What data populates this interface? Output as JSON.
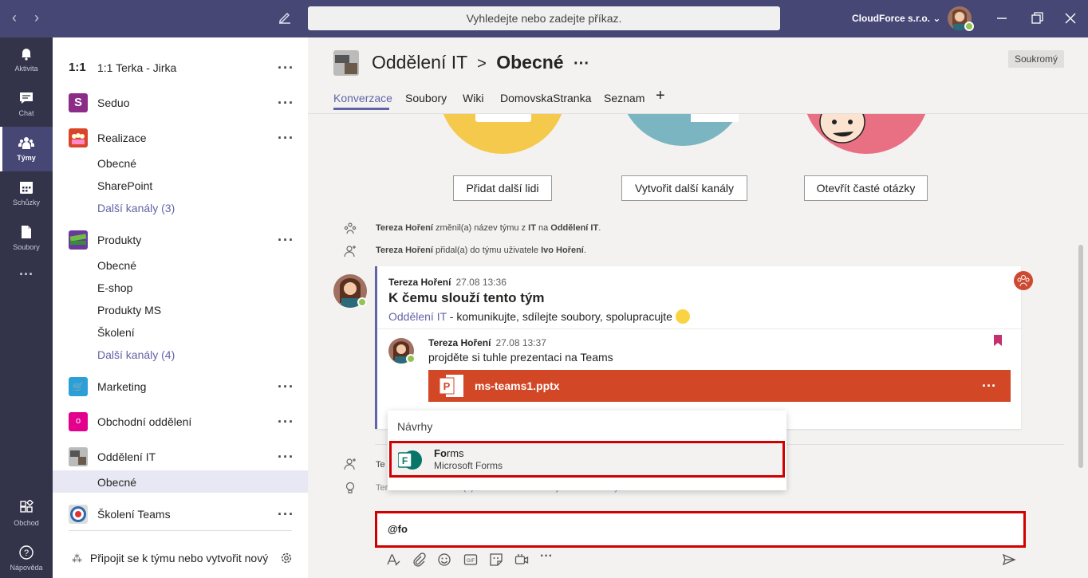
{
  "search": {
    "placeholder": "Vyhledejte nebo zadejte příkaz."
  },
  "org": "CloudForce s.r.o.",
  "rail": [
    {
      "label": "Aktivita",
      "icon": "bell-icon"
    },
    {
      "label": "Chat",
      "icon": "chat-icon"
    },
    {
      "label": "Týmy",
      "icon": "teams-icon"
    },
    {
      "label": "Schůzky",
      "icon": "calendar-icon"
    },
    {
      "label": "Soubory",
      "icon": "files-icon"
    },
    {
      "label": "Obchod",
      "icon": "store-icon"
    },
    {
      "label": "Nápověda",
      "icon": "help-icon"
    }
  ],
  "teams": {
    "t1": "1:1 Terka - Jirka",
    "t1_icon": "1:1",
    "t2": "Seduo",
    "t2_icon": "S",
    "t3": "Realizace",
    "t3_ch1": "Obecné",
    "t3_ch2": "SharePoint",
    "t3_more": "Další kanály (3)",
    "t4": "Produkty",
    "t4_ch1": "Obecné",
    "t4_ch2": "E-shop",
    "t4_ch3": "Produkty MS",
    "t4_ch4": "Školení",
    "t4_more": "Další kanály (4)",
    "t5": "Marketing",
    "t6": "Obchodní oddělení",
    "t6_icon": "o",
    "t7": "Oddělení IT",
    "t7_ch1": "Obecné",
    "t8": "Školení Teams",
    "join": "Připojit se k týmu nebo vytvořit nový"
  },
  "header": {
    "team": "Oddělení IT",
    "sep": ">",
    "channel": "Obecné",
    "private": "Soukromý",
    "tabs": [
      "Konverzace",
      "Soubory",
      "Wiki",
      "DomovskaStranka",
      "Seznam",
      "+"
    ]
  },
  "actions": [
    "Přidat další lidi",
    "Vytvořit další kanály",
    "Otevřít časté otázky"
  ],
  "sys1": {
    "pre": "Tereza Hoření",
    "a": " změnil(a) název týmu z ",
    "b": "IT",
    "c": " na ",
    "d": "Oddělení IT",
    "e": "."
  },
  "sys2": {
    "pre": "Tereza Hoření",
    "a": " přidal(a) do týmu uživatele ",
    "b": "Ivo Hoření",
    "c": "."
  },
  "post": {
    "author": "Tereza Hoření",
    "time": "27.08 13:36",
    "title": "K čemu slouží tento tým",
    "link": "Oddělení IT",
    "body": " - komunikujte, sdílejte soubory, spolupracujte "
  },
  "reply": {
    "author": "Tereza Hoření",
    "time": "27.08 13:37",
    "body": "projděte si tuhle prezentaci na Teams",
    "file": "ms-teams1.pptx"
  },
  "popup": {
    "title": "Návrhy",
    "name_bold": "Fo",
    "name_rest": "rms",
    "sub": "Microsoft Forms"
  },
  "behind": {
    "a": "Te",
    "b": "Tereza Hoření nastavil(a) uživatele Ivo Hoření jako vlastníka týmu."
  },
  "compose": {
    "value": "@fo"
  }
}
